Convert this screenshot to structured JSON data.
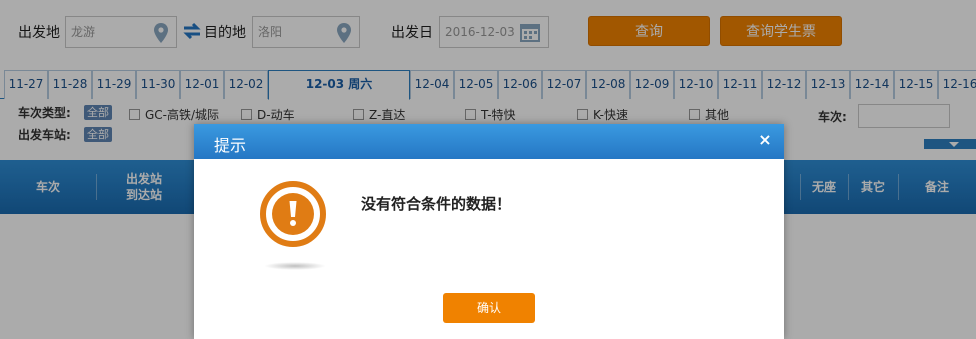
{
  "search": {
    "from_label": "出发地",
    "from_value": "龙游",
    "to_label": "目的地",
    "to_value": "洛阳",
    "date_label": "出发日",
    "date_value": "2016-12-03",
    "query_button": "查询",
    "student_button": "查询学生票",
    "accent_color": "#f08200"
  },
  "date_tabs": [
    "11-27",
    "11-28",
    "11-29",
    "11-30",
    "12-01",
    "12-02",
    "12-03 周六",
    "12-04",
    "12-05",
    "12-06",
    "12-07",
    "12-08",
    "12-09",
    "12-10",
    "12-11",
    "12-12",
    "12-13",
    "12-14",
    "12-15",
    "12-16"
  ],
  "active_date_tab": "12-03 周六",
  "filters": {
    "train_type_label": "车次类型:",
    "all_chip": "全部",
    "types": [
      "GC-高铁/城际",
      "D-动车",
      "Z-直达",
      "T-特快",
      "K-快速",
      "其他"
    ],
    "train_no_label": "车次:",
    "departure_station_label": "出发车站:",
    "departure_all_chip": "全部"
  },
  "table_header": {
    "train": "车次",
    "station_from": "出发站",
    "station_to": "到达站",
    "no_seat": "无座",
    "other": "其它",
    "remark": "备注"
  },
  "dialog": {
    "title": "提示",
    "close": "×",
    "message": "没有符合条件的数据！",
    "ok_button": "确认"
  },
  "icons": {
    "from": "location-pin-icon",
    "to": "location-pin-icon",
    "swap": "swap-arrows-icon",
    "date": "calendar-icon",
    "alert": "exclamation-icon"
  }
}
